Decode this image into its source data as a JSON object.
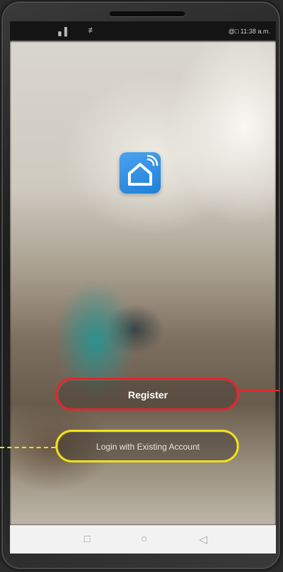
{
  "status_bar": {
    "signal_glyph": "▖▌",
    "wifi_glyph": "≢",
    "time_text": "@□ 11:38 a.m."
  },
  "app": {
    "logo_icon": "smart-home-icon",
    "accent_color": "#2a8be6"
  },
  "actions": {
    "register_label": "Register",
    "login_label": "Login with Existing Account"
  },
  "highlights": {
    "register_outline_color": "#e3262d",
    "login_outline_color": "#f1e01b"
  },
  "nav_bar": {
    "recent_glyph": "□",
    "home_glyph": "○",
    "back_glyph": "◁"
  }
}
